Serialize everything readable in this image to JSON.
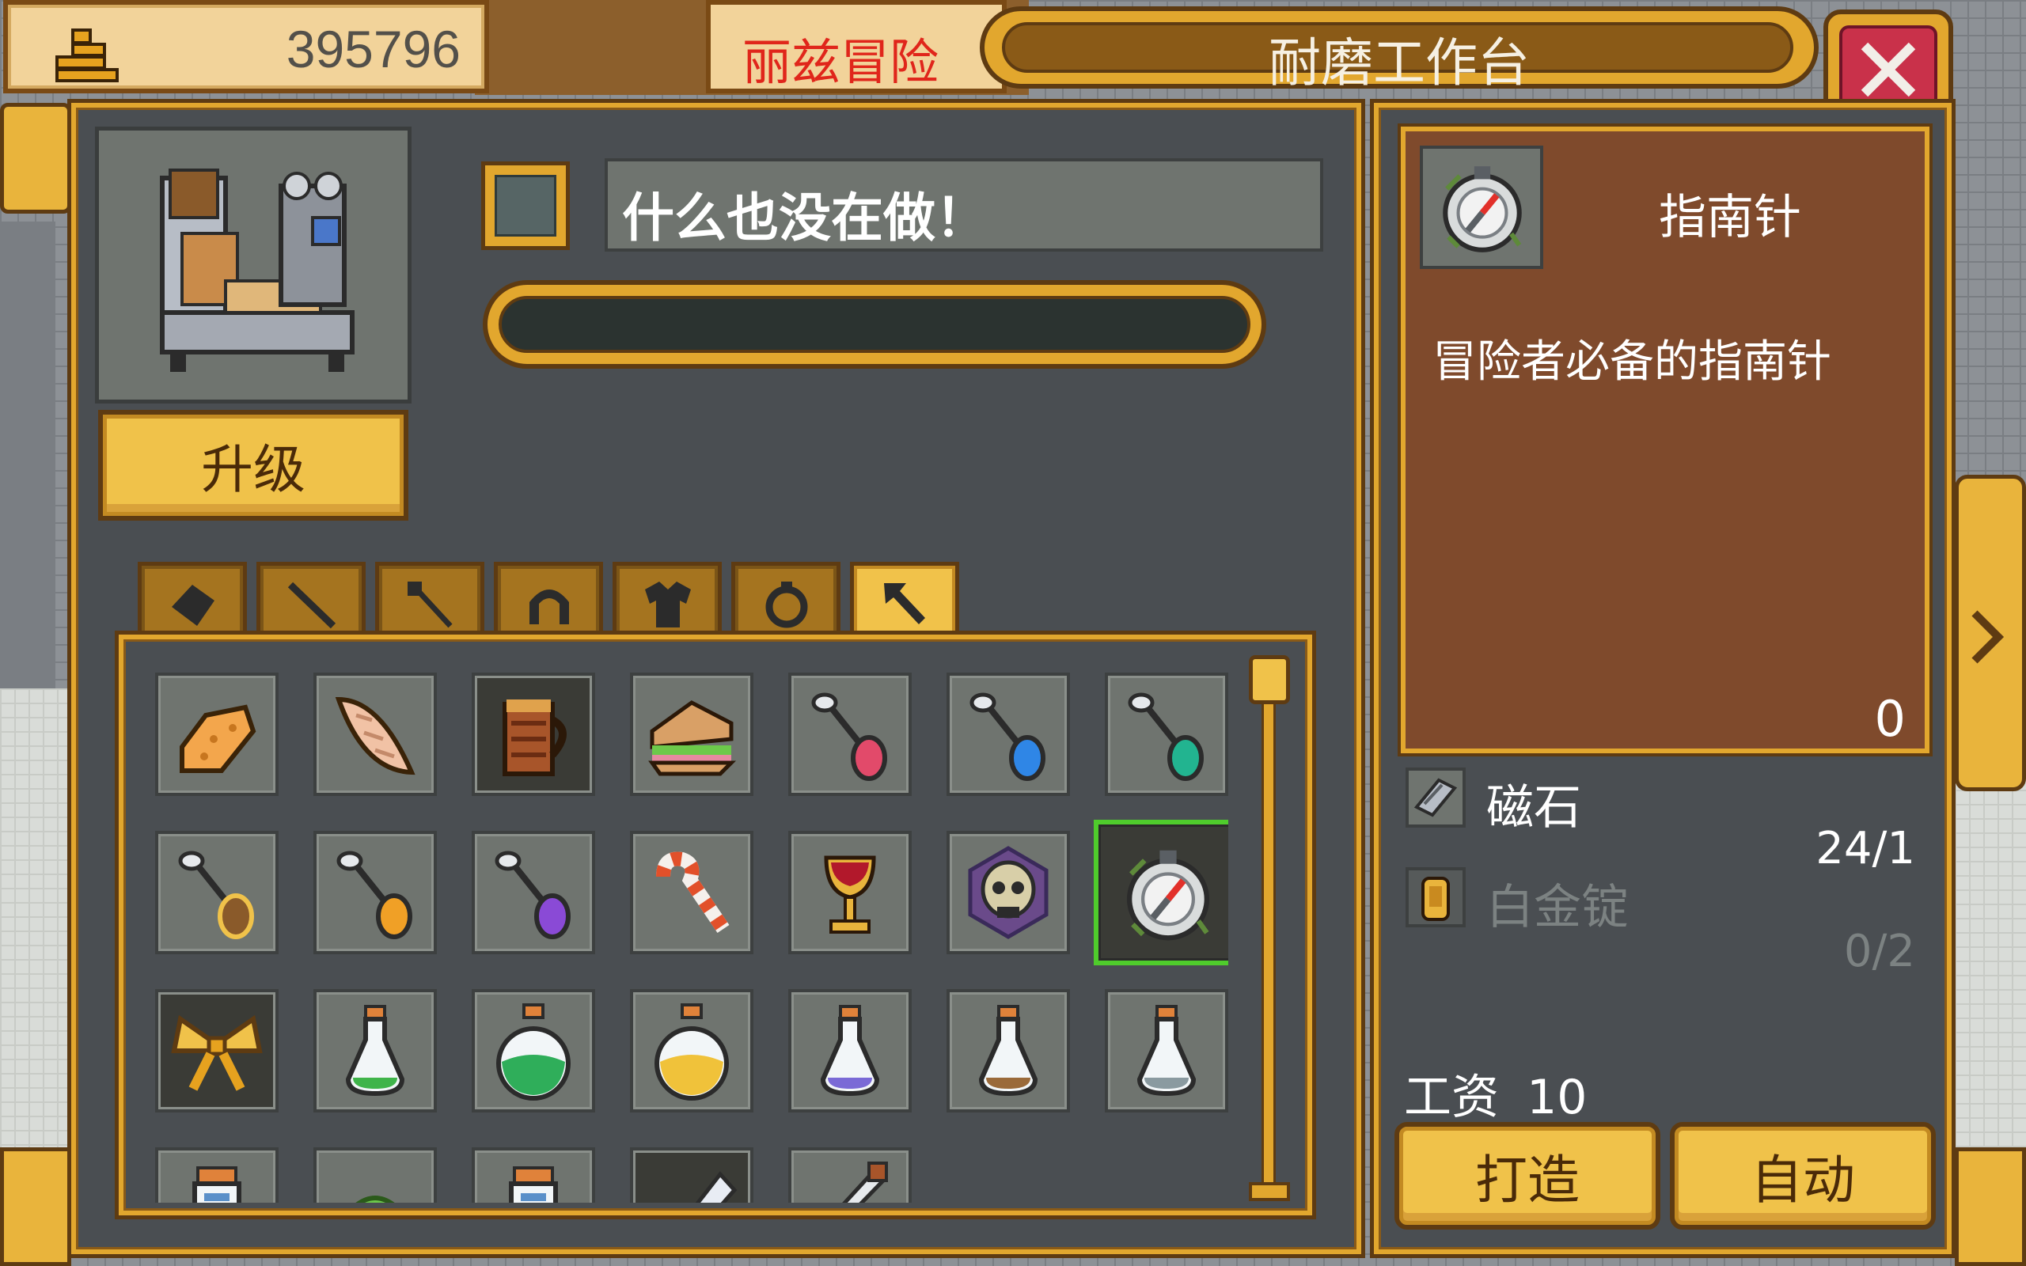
{
  "header": {
    "currency_icon": "coin-stack-icon",
    "currency_amount": "395796",
    "scene_title": "丽兹冒险",
    "workshop_title": "耐磨工作台",
    "close_icon": "close-icon"
  },
  "workbench": {
    "machine_icon": "workbench-machine-icon",
    "upgrade_label": "升级",
    "status_text": "什么也没在做！",
    "progress": 0
  },
  "category_tabs": [
    {
      "name": "tab-stone",
      "icon": "stone-icon",
      "active": false
    },
    {
      "name": "tab-staff",
      "icon": "staff-icon",
      "active": false
    },
    {
      "name": "tab-wand",
      "icon": "wand-icon",
      "active": false
    },
    {
      "name": "tab-helmet",
      "icon": "helmet-icon",
      "active": false
    },
    {
      "name": "tab-armor",
      "icon": "armor-icon",
      "active": false
    },
    {
      "name": "tab-ring",
      "icon": "ring-icon",
      "active": false
    },
    {
      "name": "tab-misc",
      "icon": "arrow-cursor-icon",
      "active": true
    }
  ],
  "inventory": {
    "rows": [
      [
        "sponge-cake-icon",
        "bread-loaf-icon",
        "tankard-icon",
        "sandwich-icon",
        "red-gem-spoon-icon",
        "blue-gem-spoon-icon",
        "green-gem-spoon-icon"
      ],
      [
        "brown-gem-spoon-icon",
        "orange-gem-spoon-icon",
        "purple-gem-spoon-icon",
        "candy-cane-icon",
        "goblet-icon",
        "skull-icon",
        "compass-icon"
      ],
      [
        "golden-bow-icon",
        "green-potion-icon",
        "large-green-potion-icon",
        "yellow-potion-icon",
        "purple-potion-icon",
        "brown-potion-icon",
        "grey-potion-icon"
      ],
      [
        "small-potion-icon",
        "green-slime-icon",
        "small-potion-icon",
        "white-feather-icon",
        "dagger-icon"
      ]
    ],
    "selected": "compass-icon"
  },
  "detail": {
    "item_icon": "compass-icon",
    "item_name": "指南针",
    "description": "冒险者必备的指南针",
    "owned_count": "0",
    "materials": [
      {
        "icon": "magnet-stone-icon",
        "name": "磁石",
        "count": "24/1",
        "available": true
      },
      {
        "icon": "platinum-ingot-icon",
        "name": "白金锭",
        "count": "0/2",
        "available": false
      }
    ],
    "wage_label": "工资",
    "wage_value": "10",
    "craft_label": "打造",
    "auto_label": "自动"
  },
  "colors": {
    "gold": "#e2a72e",
    "panel": "#4a4e52",
    "detail_bg": "#7f4a2c",
    "selected_slot": "#4fcc2c",
    "scene_title_red": "#e0261b"
  }
}
